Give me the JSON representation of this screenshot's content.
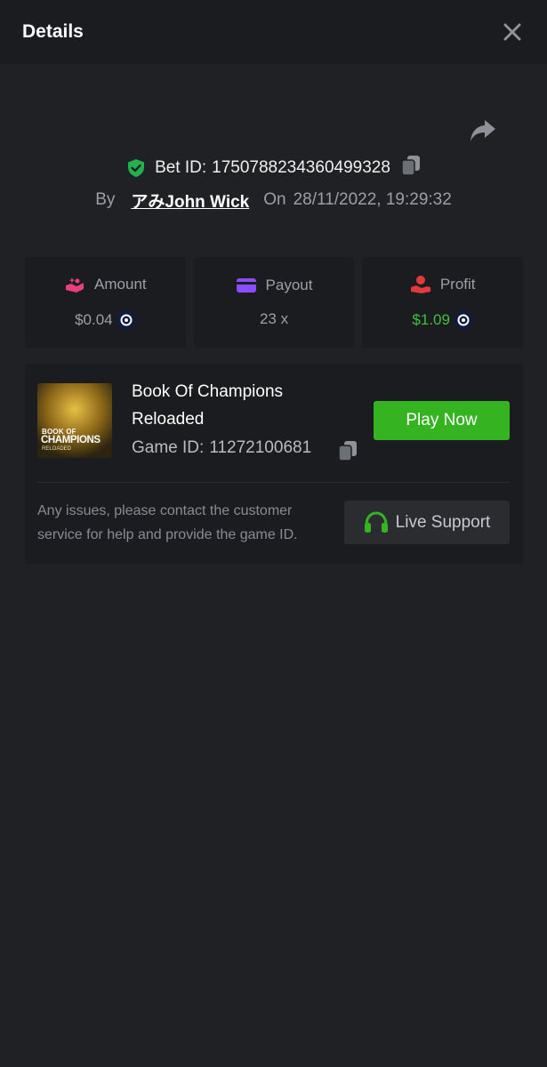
{
  "header": {
    "title": "Details"
  },
  "bet": {
    "id_label": "Bet ID:",
    "id_value": "1750788234360499328",
    "by_label": "By",
    "user": "アみJohn Wick",
    "on_label": "On",
    "datetime": "28/11/2022, 19:29:32"
  },
  "stats": {
    "amount": {
      "label": "Amount",
      "value": "$0.04"
    },
    "payout": {
      "label": "Payout",
      "value": "23 x"
    },
    "profit": {
      "label": "Profit",
      "value": "$1.09"
    }
  },
  "game": {
    "title": "Book Of Champions Reloaded",
    "id_label": "Game ID:",
    "id_value": "11272100681",
    "thumb_line1": "BOOK OF",
    "thumb_line2": "CHAMPIONS",
    "thumb_line3": "RELOADED",
    "play_label": "Play Now",
    "issue_text": "Any issues, please contact the customer service for help and provide the game ID.",
    "support_label": "Live Support"
  },
  "colors": {
    "accent_green": "#35b321",
    "profit_green": "#3ec13e",
    "amount_icon": "#e8407a",
    "payout_icon": "#8a4dff",
    "profit_icon": "#e03a3a"
  },
  "icons": {
    "close": "close-icon",
    "share": "share-icon",
    "verified": "shield-check-icon",
    "copy": "copy-icon",
    "coin": "coin-icon",
    "headset": "headset-icon"
  }
}
